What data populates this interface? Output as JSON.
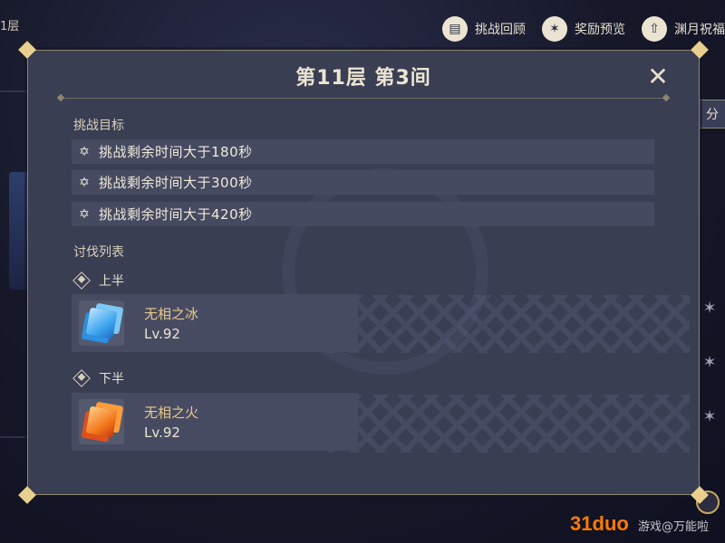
{
  "background": {
    "floor_label": "1层",
    "top_nav": [
      {
        "icon": "book-icon",
        "label": "挑战回顾"
      },
      {
        "icon": "star-icon",
        "label": "奖励预览"
      },
      {
        "icon": "upgrade-icon",
        "label": "渊月祝福"
      }
    ],
    "right_peek_text": "分",
    "watermark_brand": "31duo",
    "watermark_text": "游戏@万能啦"
  },
  "modal": {
    "title": "第11层 第3间",
    "close_icon": "close-icon",
    "objectives_label": "挑战目标",
    "objectives": [
      {
        "text": "挑战剩余时间大于180秒"
      },
      {
        "text": "挑战剩余时间大于300秒"
      },
      {
        "text": "挑战剩余时间大于420秒"
      }
    ],
    "enemy_list_label": "讨伐列表",
    "halves": [
      {
        "label": "上半",
        "enemy": {
          "name": "无相之冰",
          "level": "Lv.92",
          "element": "ice"
        }
      },
      {
        "label": "下半",
        "enemy": {
          "name": "无相之火",
          "level": "Lv.92",
          "element": "fire"
        }
      }
    ]
  },
  "colors": {
    "panel": "#3a3e53",
    "accent_gold": "#e9cf8e",
    "enemy_name": "#e8c98a"
  }
}
